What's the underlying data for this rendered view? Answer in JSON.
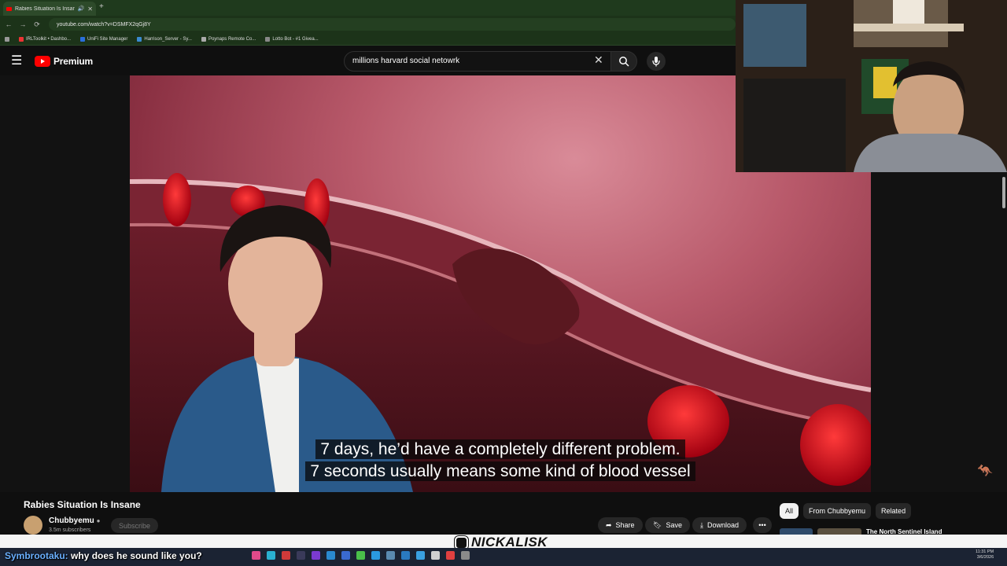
{
  "browser": {
    "tab_title": "Rabies Situation Is Insane",
    "new_tab": "+",
    "url": "youtube.com/watch?v=DSMFX2qGj8Y",
    "bookmarks": [
      "IRLToolkit • Dashbo...",
      "UniFi Site Manager",
      "Harrison_Server - Sy...",
      "Poynaps Remote Co...",
      "Lotto Bot - #1 Givea..."
    ]
  },
  "youtube": {
    "logo_text": "Premium",
    "search_value": "millions harvard social netowrk"
  },
  "video": {
    "caption_line1": "7 days, he’d have a completely different problem.",
    "caption_line2": "7 seconds usually means some kind of blood vessel",
    "title": "Rabies Situation Is Insane",
    "channel": "Chubbyemu",
    "subscribers": "3.5m subscribers",
    "subscribe_label": "Subscribe",
    "share_label": "Share",
    "save_label": "Save",
    "download_label": "Download"
  },
  "related": {
    "chips": [
      "All",
      "From Chubbyemu",
      "Related"
    ],
    "first_title": "The North Sentinel Island"
  },
  "stream": {
    "chat_user": "Symbrootaku:",
    "chat_text": "why does he sound like you?",
    "brand": "NICKALISK",
    "clock_time": "11:31 PM",
    "clock_date": "3/6/2026"
  }
}
